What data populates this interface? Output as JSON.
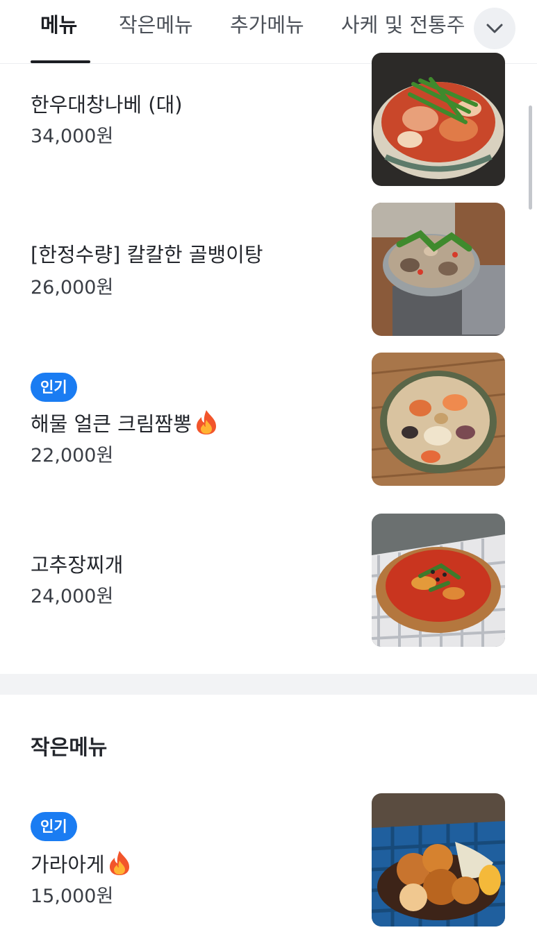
{
  "tabs": [
    {
      "label": "메뉴",
      "active": true
    },
    {
      "label": "작은메뉴",
      "active": false
    },
    {
      "label": "추가메뉴",
      "active": false
    },
    {
      "label": "사케 및 전통주",
      "active": false
    }
  ],
  "more_button_icon": "chevron-down-icon",
  "accent_color": "#1a7cf2",
  "main_menu": [
    {
      "name": "한우대창나베 (대)",
      "price": "34,000원",
      "badge": null,
      "hot": false,
      "image": "nabe-hotpot-photo"
    },
    {
      "name": "[한정수량] 칼칼한 골뱅이탕",
      "price": "26,000원",
      "badge": null,
      "hot": false,
      "image": "golbaengi-stew-photo"
    },
    {
      "name": "해물 얼큰 크림짬뽕",
      "price": "22,000원",
      "badge": "인기",
      "hot": true,
      "image": "cream-jjamppong-photo"
    },
    {
      "name": "고추장찌개",
      "price": "24,000원",
      "badge": null,
      "hot": false,
      "image": "gochujang-stew-photo"
    }
  ],
  "small_menu": {
    "title": "작은메뉴",
    "items": [
      {
        "name": "가라아게",
        "price": "15,000원",
        "badge": "인기",
        "hot": true,
        "image": "karaage-photo"
      }
    ]
  }
}
